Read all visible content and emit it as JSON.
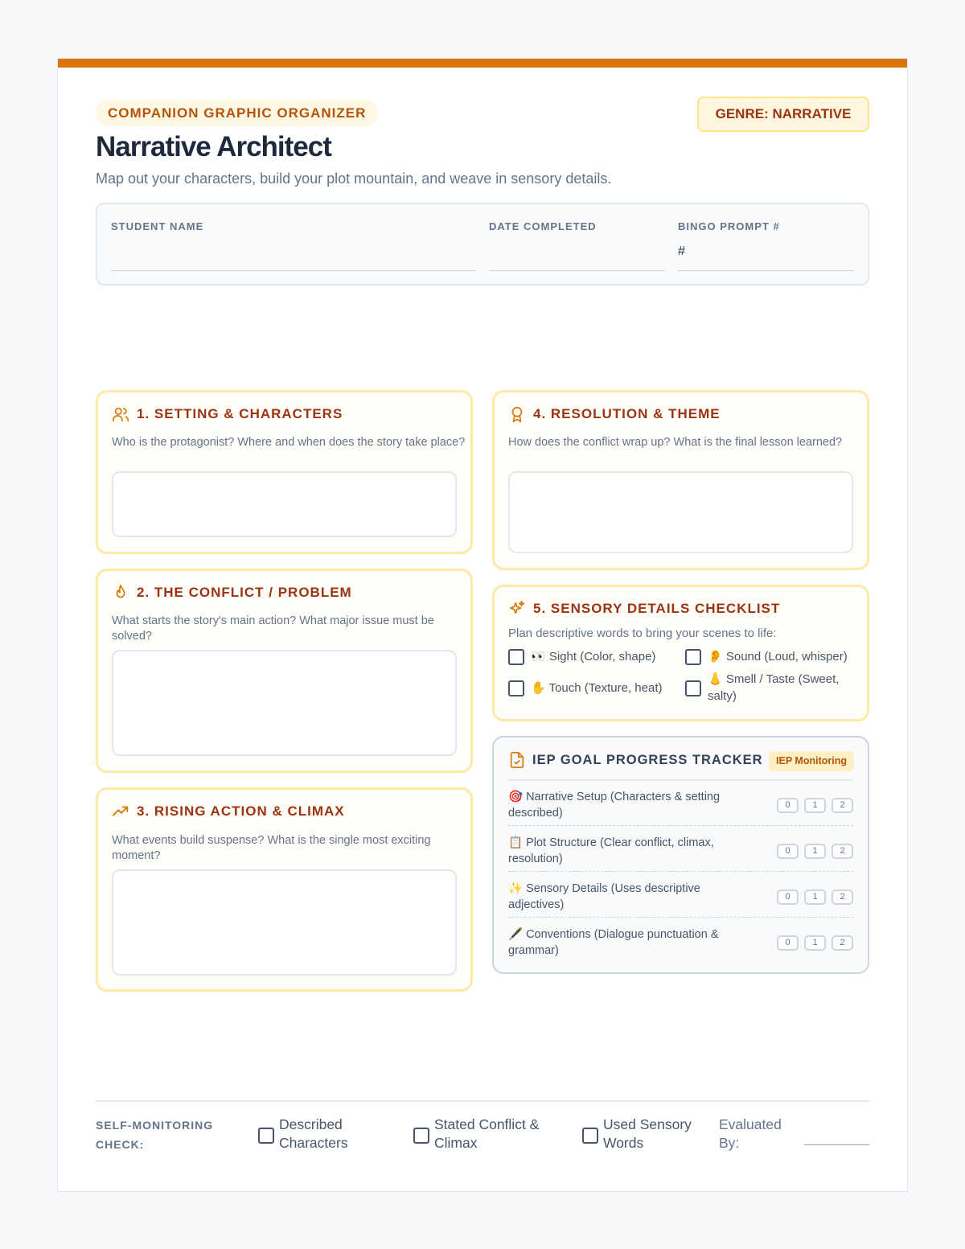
{
  "header": {
    "eyebrow": "COMPANION GRAPHIC ORGANIZER",
    "genre": "GENRE: NARRATIVE",
    "title": "Narrative Architect",
    "subtitle": "Map out your characters, build your plot mountain, and weave in sensory details."
  },
  "info": {
    "student_label": "STUDENT NAME",
    "date_label": "DATE COMPLETED",
    "prompt_label": "BINGO PROMPT #",
    "prompt_value": "#"
  },
  "sections": {
    "setting": {
      "title": "1. SETTING & CHARACTERS",
      "question": "Who is the protagonist? Where and when does the story take place?"
    },
    "conflict": {
      "title": "2. THE CONFLICT / PROBLEM",
      "question": "What starts the story's main action? What major issue must be solved?"
    },
    "rising": {
      "title": "3. RISING ACTION & CLIMAX",
      "question": "What events build suspense? What is the single most exciting moment?"
    },
    "resolution": {
      "title": "4. RESOLUTION & THEME",
      "question": "How does the conflict wrap up? What is the final lesson learned?"
    },
    "sensory": {
      "title": "5. SENSORY DETAILS CHECKLIST",
      "question": "Plan descriptive words to bring your scenes to life:",
      "items": [
        "👀 Sight (Color, shape)",
        "👂 Sound (Loud, whisper)",
        "✋ Touch (Texture, heat)",
        "👃 Smell / Taste (Sweet, salty)"
      ]
    }
  },
  "iep": {
    "title": "IEP GOAL PROGRESS TRACKER",
    "badge": "IEP Monitoring",
    "goals": [
      "🎯 Narrative Setup (Characters & setting described)",
      "📋 Plot Structure (Clear conflict, climax, resolution)",
      "✨ Sensory Details (Uses descriptive adjectives)",
      "🖋️ Conventions (Dialogue punctuation & grammar)"
    ],
    "scores": [
      "0",
      "1",
      "2"
    ]
  },
  "footer": {
    "label_line1": "SELF-MONITORING",
    "label_line2": "CHECK:",
    "checks": [
      "Described Characters",
      "Stated Conflict & Climax",
      "Used Sensory Words"
    ],
    "evaluated_by": "Evaluated By:"
  },
  "colors": {
    "accent": "#d97706",
    "heading": "#9a3412",
    "card_border": "#fde9a8"
  },
  "icons": {
    "setting": "users-icon",
    "conflict": "flame-icon",
    "rising": "trending-up-icon",
    "resolution": "award-icon",
    "sensory": "sparkles-icon",
    "iep": "file-check-icon"
  }
}
